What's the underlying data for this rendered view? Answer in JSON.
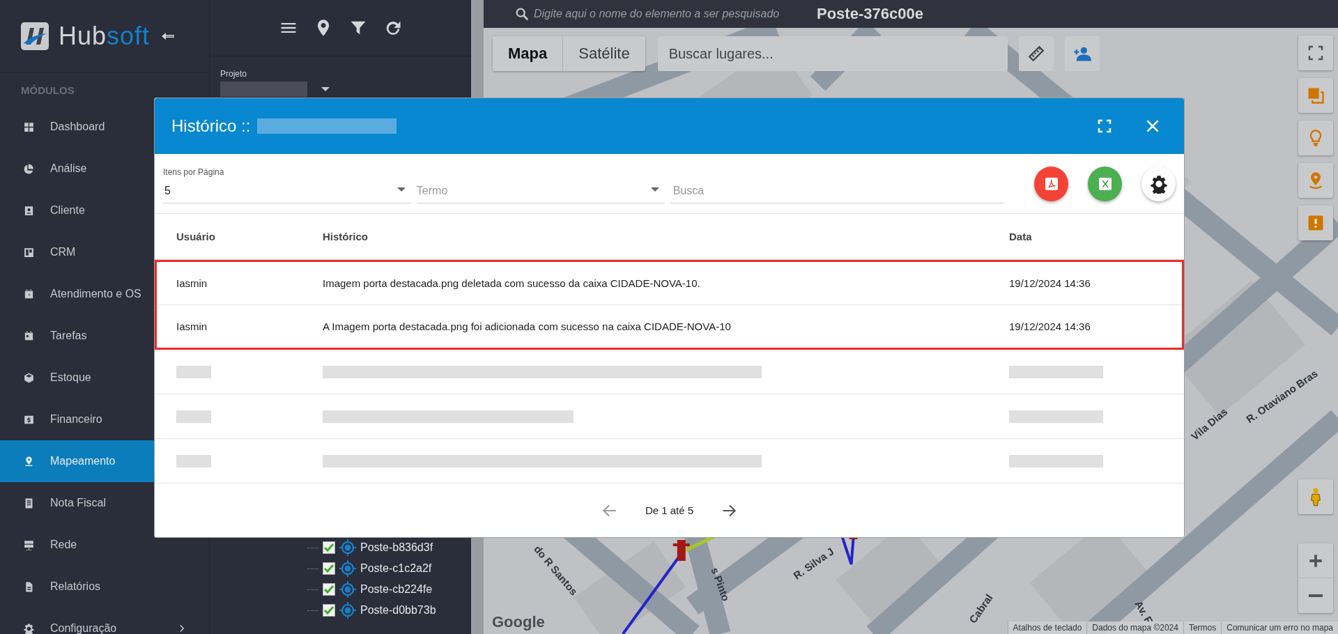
{
  "sidebar": {
    "brand": {
      "prefix": "Hub",
      "suffix": "soft"
    },
    "section_label": "MÓDULOS",
    "items": [
      {
        "label": "Dashboard",
        "selected": false,
        "submenu": false
      },
      {
        "label": "Análise",
        "selected": false,
        "submenu": false
      },
      {
        "label": "Cliente",
        "selected": false,
        "submenu": false
      },
      {
        "label": "CRM",
        "selected": false,
        "submenu": false
      },
      {
        "label": "Atendimento e OS",
        "selected": false,
        "submenu": false
      },
      {
        "label": "Tarefas",
        "selected": false,
        "submenu": false
      },
      {
        "label": "Estoque",
        "selected": false,
        "submenu": false
      },
      {
        "label": "Financeiro",
        "selected": false,
        "submenu": false
      },
      {
        "label": "Mapeamento",
        "selected": true,
        "submenu": false
      },
      {
        "label": "Nota Fiscal",
        "selected": false,
        "submenu": false
      },
      {
        "label": "Rede",
        "selected": false,
        "submenu": false
      },
      {
        "label": "Relatórios",
        "selected": false,
        "submenu": false
      },
      {
        "label": "Configuração",
        "selected": false,
        "submenu": true
      }
    ]
  },
  "tree": {
    "project_label": "Projeto",
    "items": [
      {
        "label": "Poste-b836d3f",
        "checked": true
      },
      {
        "label": "Poste-c1c2a2f",
        "checked": true
      },
      {
        "label": "Poste-cb224fe",
        "checked": true
      },
      {
        "label": "Poste-d0bb73b",
        "checked": true
      }
    ]
  },
  "topbar": {
    "search_placeholder": "Digite aqui o nome do elemento a ser pesquisado",
    "element_name": "Poste-376c00e"
  },
  "map": {
    "type_buttons": [
      {
        "label": "Mapa",
        "selected": true
      },
      {
        "label": "Satélite",
        "selected": false
      }
    ],
    "search_placeholder": "Buscar lugares...",
    "street_labels": [
      "R. Otaviano Bras",
      "Vila Dias",
      "Cabral",
      "R. Silva J",
      "s Pinto",
      "do R Santos",
      "Av. F"
    ],
    "logo": "Google",
    "attribution": [
      "Atalhos de teclado",
      "Dados do mapa ©2024",
      "Termos",
      "Comunicar um erro no mapa"
    ]
  },
  "modal": {
    "title": "Histórico ::",
    "per_page_label": "Itens por Página",
    "per_page": "5",
    "term_placeholder": "Termo",
    "search_placeholder": "Busca",
    "columns": [
      "Usuário",
      "Histórico",
      "Data"
    ],
    "rows": [
      {
        "user": "Iasmin",
        "text": "Imagem porta destacada.png deletada com sucesso da caixa CIDADE-NOVA-10.",
        "date": "19/12/2024 14:36",
        "highlighted": true
      },
      {
        "user": "Iasmin",
        "text": "A Imagem porta destacada.png foi adicionada com sucesso na caixa CIDADE-NOVA-10",
        "date": "19/12/2024 14:36",
        "highlighted": true
      }
    ],
    "pagination": "De 1 até 5"
  }
}
